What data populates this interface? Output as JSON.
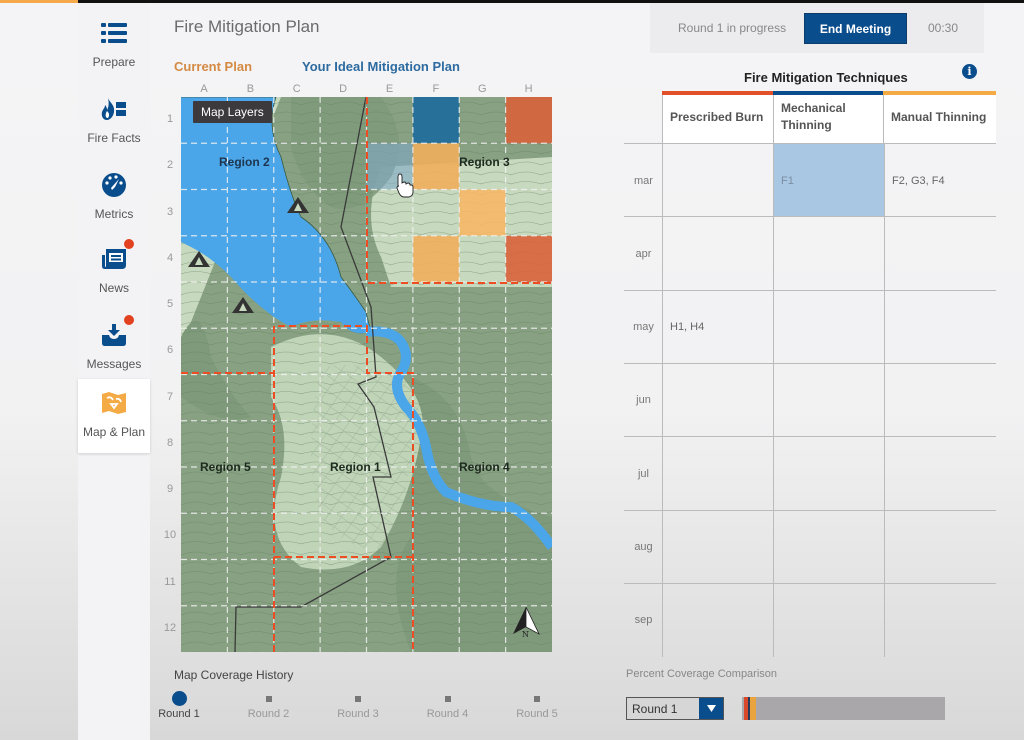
{
  "app": {
    "title": "Fire Mitigation Plan"
  },
  "sidebar": {
    "items": [
      {
        "label": "Prepare",
        "icon": "list-icon",
        "badge": false,
        "active": false
      },
      {
        "label": "Fire Facts",
        "icon": "fire-facts-icon",
        "badge": false,
        "active": false
      },
      {
        "label": "Metrics",
        "icon": "gauge-icon",
        "badge": false,
        "active": false
      },
      {
        "label": "News",
        "icon": "newspaper-icon",
        "badge": true,
        "active": false
      },
      {
        "label": "Messages",
        "icon": "inbox-download-icon",
        "badge": true,
        "active": false
      },
      {
        "label": "Map & Plan",
        "icon": "map-icon",
        "badge": false,
        "active": true
      }
    ]
  },
  "plan_tabs": {
    "current": "Current Plan",
    "ideal": "Your Ideal Mitigation Plan"
  },
  "map": {
    "layers_button": "Map Layers",
    "columns": [
      "A",
      "B",
      "C",
      "D",
      "E",
      "F",
      "G",
      "H"
    ],
    "rows": [
      "1",
      "2",
      "3",
      "4",
      "5",
      "6",
      "7",
      "8",
      "9",
      "10",
      "11",
      "12"
    ],
    "regions": [
      {
        "label": "Region 1"
      },
      {
        "label": "Region 2"
      },
      {
        "label": "Region 3"
      },
      {
        "label": "Region 4"
      },
      {
        "label": "Region 5"
      }
    ],
    "selected_cells": [
      {
        "cell": "F1",
        "technique": "Mechanical Thinning",
        "color": "#1c6a9c"
      },
      {
        "cell": "H1",
        "technique": "Prescribed Burn",
        "color": "#d8623a"
      },
      {
        "cell": "E2",
        "technique": "hover",
        "color": "#7fa8c8"
      },
      {
        "cell": "F2",
        "technique": "Manual Thinning",
        "color": "#f0ae5c"
      },
      {
        "cell": "G3",
        "technique": "Manual Thinning",
        "color": "#f6b766"
      },
      {
        "cell": "F4",
        "technique": "Manual Thinning",
        "color": "#f0ae5c"
      },
      {
        "cell": "H4",
        "technique": "Prescribed Burn",
        "color": "#d8623a"
      }
    ]
  },
  "session": {
    "status": "Round 1 in progress",
    "end_button": "End Meeting",
    "timer": "00:30"
  },
  "techniques": {
    "title": "Fire Mitigation Techniques",
    "columns": [
      {
        "label": "Prescribed Burn",
        "color": "#e2502a"
      },
      {
        "label": "Mechanical Thinning",
        "color": "#0a4d8c"
      },
      {
        "label": "Manual Thinning",
        "color": "#f5ab45"
      }
    ],
    "rows": [
      {
        "month": "mar",
        "cells": [
          "",
          "F1",
          "F2, G3, F4"
        ]
      },
      {
        "month": "apr",
        "cells": [
          "",
          "",
          ""
        ]
      },
      {
        "month": "may",
        "cells": [
          "H1, H4",
          "",
          ""
        ]
      },
      {
        "month": "jun",
        "cells": [
          "",
          "",
          ""
        ]
      },
      {
        "month": "jul",
        "cells": [
          "",
          "",
          ""
        ]
      },
      {
        "month": "aug",
        "cells": [
          "",
          "",
          ""
        ]
      },
      {
        "month": "sep",
        "cells": [
          "",
          "",
          ""
        ]
      }
    ],
    "selected_cell": {
      "month": "mar",
      "column": "Mechanical Thinning"
    }
  },
  "history": {
    "title": "Map Coverage History",
    "rounds": [
      {
        "label": "Round 1",
        "active": true
      },
      {
        "label": "Round 2",
        "active": false
      },
      {
        "label": "Round 3",
        "active": false
      },
      {
        "label": "Round 4",
        "active": false
      },
      {
        "label": "Round 5",
        "active": false
      }
    ]
  },
  "coverage": {
    "title": "Percent Coverage Comparison",
    "selected_round": "Round 1",
    "segments": [
      {
        "technique": "Prescribed Burn",
        "percent": 2,
        "color": "#d9482b"
      },
      {
        "technique": "Mechanical Thinning",
        "percent": 1,
        "color": "#283a5c"
      },
      {
        "technique": "Manual Thinning",
        "percent": 3,
        "color": "#e9a33f"
      }
    ]
  }
}
